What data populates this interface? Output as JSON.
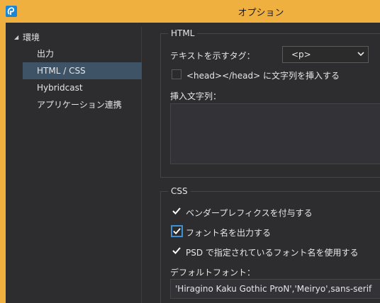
{
  "window": {
    "title": "オプション",
    "app_icon": "app-logo-icon"
  },
  "sidebar": {
    "root_label": "環境",
    "items": [
      {
        "label": "出力"
      },
      {
        "label": "HTML / CSS",
        "selected": true
      },
      {
        "label": "Hybridcast"
      },
      {
        "label": "アプリケーション連携"
      }
    ]
  },
  "html_group": {
    "title": "HTML",
    "tag_label": "テキストを示すタグ：",
    "tag_value": "<p>",
    "head_checkbox_label": "<head></head> に文字列を挿入する",
    "head_checkbox_checked": false,
    "insert_label": "挿入文字列：",
    "insert_value": ""
  },
  "css_group": {
    "title": "CSS",
    "vendor_prefix_label": "ベンダープレフィクスを付与する",
    "vendor_prefix_checked": true,
    "output_font_label": "フォント名を出力する",
    "output_font_checked": true,
    "psd_font_label": "PSD で指定されているフォント名を使用する",
    "psd_font_checked": true,
    "default_font_label": "デフォルトフォント：",
    "default_font_value": "'Hiragino Kaku Gothic ProN','Meiryo',sans-serif"
  },
  "colors": {
    "title_bar": "#f0b040",
    "background": "#2d2d30",
    "selection": "#3e5366",
    "focus": "#3d8fd6"
  }
}
